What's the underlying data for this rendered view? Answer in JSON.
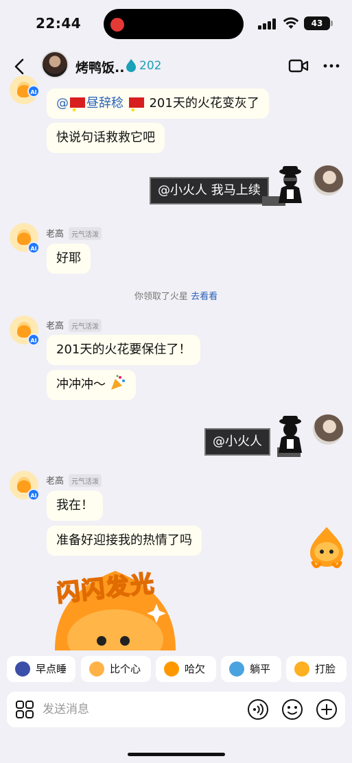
{
  "status_bar": {
    "time": "22:44",
    "battery": "43"
  },
  "header": {
    "name": "烤鸭饭..",
    "streak": "202"
  },
  "messages": {
    "m1_mention": "@",
    "m1_name": "昼辞稔",
    "m1_text": "201天的火花变灰了",
    "m2_text": "快说句话救救它吧",
    "u1_text": "@小火人 我马上续",
    "ai_name": "老高",
    "ai_tag": "元气活泼",
    "ai_badge": "AI",
    "m3_text": "好耶",
    "system_text": "你领取了火星",
    "system_link": "去看看",
    "m4_text": "201天的火花要保住了！",
    "m5_text": "冲冲冲～",
    "u2_text": "@小火人",
    "m6_text": "我在！",
    "m7_text": "准备好迎接我的热情了吗",
    "sticker_text": "闪闪发光"
  },
  "quick_replies": [
    "早点睡",
    "比个心",
    "哈欠",
    "躺平",
    "打脸"
  ],
  "input": {
    "placeholder": "发送消息"
  },
  "colors": {
    "bubble": "#fffef0",
    "background": "#f1f0f6",
    "accent": "#2a62b9",
    "streak": "#1aa0b8"
  }
}
